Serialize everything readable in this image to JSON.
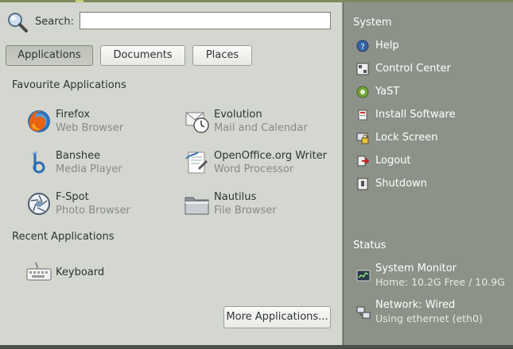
{
  "search": {
    "label": "Search:",
    "value": "",
    "placeholder": ""
  },
  "tabs": [
    {
      "label": "Applications",
      "active": true
    },
    {
      "label": "Documents",
      "active": false
    },
    {
      "label": "Places",
      "active": false
    }
  ],
  "favourites": {
    "title": "Favourite Applications",
    "apps": [
      {
        "name": "Firefox",
        "desc": "Web Browser",
        "icon": "firefox-icon"
      },
      {
        "name": "Evolution",
        "desc": "Mail and Calendar",
        "icon": "evolution-icon"
      },
      {
        "name": "Banshee",
        "desc": "Media Player",
        "icon": "banshee-icon"
      },
      {
        "name": "OpenOffice.org Writer",
        "desc": "Word Processor",
        "icon": "writer-icon"
      },
      {
        "name": "F-Spot",
        "desc": "Photo Browser",
        "icon": "fspot-icon"
      },
      {
        "name": "Nautilus",
        "desc": "File Browser",
        "icon": "nautilus-icon"
      }
    ]
  },
  "recent": {
    "title": "Recent Applications",
    "apps": [
      {
        "name": "Keyboard",
        "icon": "keyboard-icon"
      }
    ]
  },
  "more_button": "More Applications...",
  "system": {
    "title": "System",
    "items": [
      {
        "label": "Help",
        "icon": "help-icon"
      },
      {
        "label": "Control Center",
        "icon": "control-center-icon"
      },
      {
        "label": "YaST",
        "icon": "yast-icon"
      },
      {
        "label": "Install Software",
        "icon": "install-software-icon"
      },
      {
        "label": "Lock Screen",
        "icon": "lock-icon"
      },
      {
        "label": "Logout",
        "icon": "logout-icon"
      },
      {
        "label": "Shutdown",
        "icon": "shutdown-icon"
      }
    ]
  },
  "status": {
    "title": "Status",
    "monitor": {
      "label": "System Monitor",
      "detail": "Home: 10.2G Free / 10.9G",
      "icon": "system-monitor-icon"
    },
    "network": {
      "label": "Network: Wired",
      "detail": "Using ethernet (eth0)",
      "icon": "network-icon"
    }
  }
}
